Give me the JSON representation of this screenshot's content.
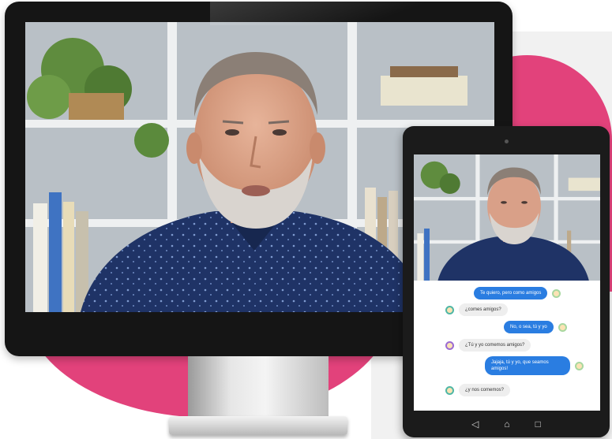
{
  "chat": {
    "messages": [
      {
        "side": "out",
        "text": "Te quiero, pero como amigos"
      },
      {
        "side": "in",
        "text": "¿comes amigos?"
      },
      {
        "side": "out",
        "text": "No, o sea, tú y yo"
      },
      {
        "side": "in",
        "text": "¿Tú y yo comemos amigos?"
      },
      {
        "side": "out",
        "text": "Jajaja, tú y yo, que seamos amigos!"
      },
      {
        "side": "in",
        "text": "¿y nos comemos?"
      }
    ]
  },
  "navbar": {
    "back_icon": "back-icon",
    "home_icon": "home-icon",
    "recents_icon": "recents-icon"
  },
  "colors": {
    "accent_pink": "#e2427b",
    "bubble_blue": "#2a7de1",
    "bubble_gray": "#eeeeee"
  }
}
